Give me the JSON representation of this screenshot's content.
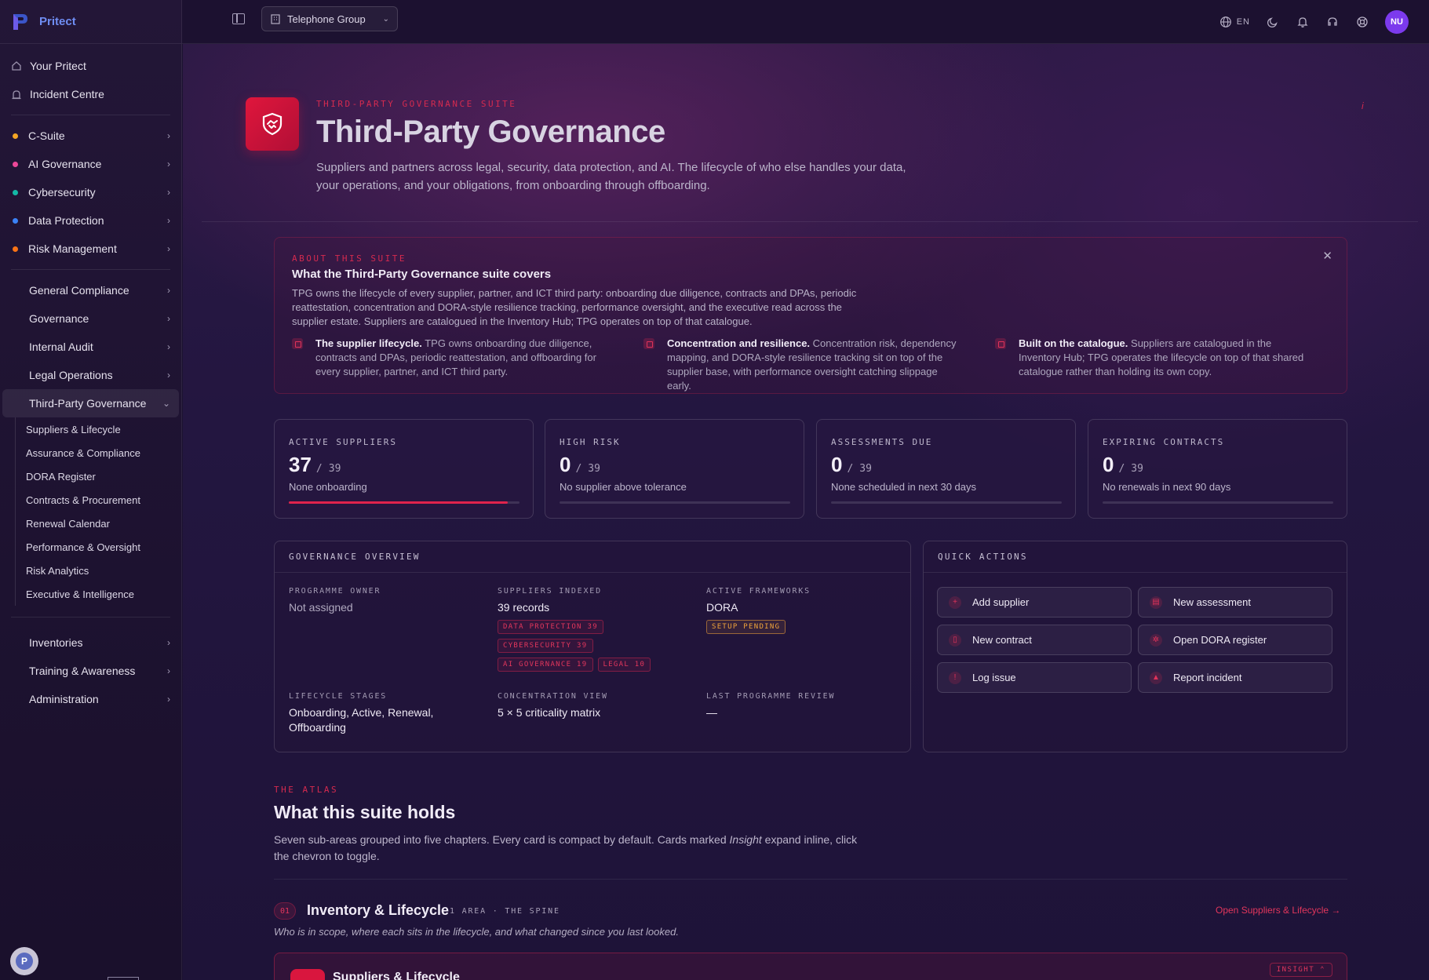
{
  "brand": {
    "name": "Pritect"
  },
  "sidebar": {
    "top_items": [
      {
        "label": "Your Pritect",
        "icon": "home-icon"
      },
      {
        "label": "Incident Centre",
        "icon": "siren-icon"
      }
    ],
    "suites": [
      {
        "label": "C-Suite",
        "color": "#f5a524"
      },
      {
        "label": "AI Governance",
        "color": "#ec4899"
      },
      {
        "label": "Cybersecurity",
        "color": "#14b8a6"
      },
      {
        "label": "Data Protection",
        "color": "#3b82f6"
      },
      {
        "label": "Risk Management",
        "color": "#f97316"
      }
    ],
    "groups": [
      {
        "label": "General Compliance"
      },
      {
        "label": "Governance"
      },
      {
        "label": "Internal Audit"
      },
      {
        "label": "Legal Operations"
      }
    ],
    "active_group": "Third-Party Governance",
    "sub_items": [
      "Suppliers & Lifecycle",
      "Assurance & Compliance",
      "DORA Register",
      "Contracts & Procurement",
      "Renewal Calendar",
      "Performance & Oversight",
      "Risk Analytics",
      "Executive & Intelligence"
    ],
    "bottom_groups": [
      {
        "label": "Inventories"
      },
      {
        "label": "Training & Awareness"
      },
      {
        "label": "Administration"
      }
    ]
  },
  "topbar": {
    "org": "Telephone Group",
    "lang": "EN",
    "avatar_initials": "NU"
  },
  "hero": {
    "eyebrow": "THIRD-PARTY GOVERNANCE SUITE",
    "title": "Third-Party Governance",
    "subtitle": "Suppliers and partners across legal, security, data protection, and AI. The lifecycle of who else handles your data, your operations, and your obligations, from onboarding through offboarding.",
    "mark": "i"
  },
  "about": {
    "eyebrow": "ABOUT THIS SUITE",
    "title": "What the Third-Party Governance suite covers",
    "text": "TPG owns the lifecycle of every supplier, partner, and ICT third party: onboarding due diligence, contracts and DPAs, periodic reattestation, concentration and DORA-style resilience tracking, performance oversight, and the executive read across the supplier estate. Suppliers are catalogued in the Inventory Hub; TPG operates on top of that catalogue.",
    "columns": [
      {
        "bold": "The supplier lifecycle.",
        "text": " TPG owns onboarding due diligence, contracts and DPAs, periodic reattestation, and offboarding for every supplier, partner, and ICT third party."
      },
      {
        "bold": "Concentration and resilience.",
        "text": " Concentration risk, dependency mapping, and DORA-style resilience tracking sit on top of the supplier base, with performance oversight catching slippage early."
      },
      {
        "bold": "Built on the catalogue.",
        "text": " Suppliers are catalogued in the Inventory Hub; TPG operates the lifecycle on top of that shared catalogue rather than holding its own copy."
      }
    ]
  },
  "stats": [
    {
      "label": "ACTIVE SUPPLIERS",
      "value": "37",
      "total": "39",
      "note": "None onboarding",
      "progress": 0.95
    },
    {
      "label": "HIGH RISK",
      "value": "0",
      "total": "39",
      "note": "No supplier above tolerance",
      "progress": 0
    },
    {
      "label": "ASSESSMENTS DUE",
      "value": "0",
      "total": "39",
      "note": "None scheduled in next 30 days",
      "progress": 0
    },
    {
      "label": "EXPIRING CONTRACTS",
      "value": "0",
      "total": "39",
      "note": "No renewals in next 90 days",
      "progress": 0
    }
  ],
  "governance": {
    "title": "GOVERNANCE OVERVIEW",
    "programme_owner_label": "PROGRAMME OWNER",
    "programme_owner": "Not assigned",
    "suppliers_indexed_label": "SUPPLIERS INDEXED",
    "suppliers_indexed": "39 records",
    "indexed_tags": [
      "DATA PROTECTION 39",
      "CYBERSECURITY 39",
      "AI GOVERNANCE 19",
      "LEGAL 10"
    ],
    "frameworks_label": "ACTIVE FRAMEWORKS",
    "frameworks": "DORA",
    "framework_tag": "SETUP PENDING",
    "lifecycle_label": "LIFECYCLE STAGES",
    "lifecycle": "Onboarding, Active, Renewal, Offboarding",
    "concentration_label": "CONCENTRATION VIEW",
    "concentration": "5 × 5 criticality matrix",
    "last_review_label": "LAST PROGRAMME REVIEW",
    "last_review": "—"
  },
  "quick_actions": {
    "title": "QUICK ACTIONS",
    "buttons": [
      {
        "label": "Add supplier",
        "icon": "plus-icon",
        "glyph": "+"
      },
      {
        "label": "New assessment",
        "icon": "clipboard-icon",
        "glyph": "▤"
      },
      {
        "label": "New contract",
        "icon": "file-icon",
        "glyph": "▯"
      },
      {
        "label": "Open DORA register",
        "icon": "register-icon",
        "glyph": "✲"
      },
      {
        "label": "Log issue",
        "icon": "alert-circle-icon",
        "glyph": "!"
      },
      {
        "label": "Report incident",
        "icon": "warning-icon",
        "glyph": "▲"
      }
    ]
  },
  "atlas": {
    "eyebrow": "THE ATLAS",
    "title": "What this suite holds",
    "subtitle_a": "Seven sub-areas grouped into five chapters. Every card is compact by default. Cards marked ",
    "subtitle_em": "Insight",
    "subtitle_b": " expand inline, click the chevron to toggle.",
    "chapter": {
      "num": "01",
      "title": "Inventory & Lifecycle",
      "meta": "1 AREA · THE SPINE",
      "link": "Open Suppliers & Lifecycle →",
      "subtitle": "Who is in scope, where each sits in the lifecycle, and what changed since you last looked."
    },
    "card": {
      "title": "Suppliers & Lifecycle",
      "badge": "INSIGHT ⌃"
    }
  },
  "colors": {
    "accent": "#e0234c",
    "brand": "#6f8df2",
    "avatar": "#7c3aed"
  }
}
